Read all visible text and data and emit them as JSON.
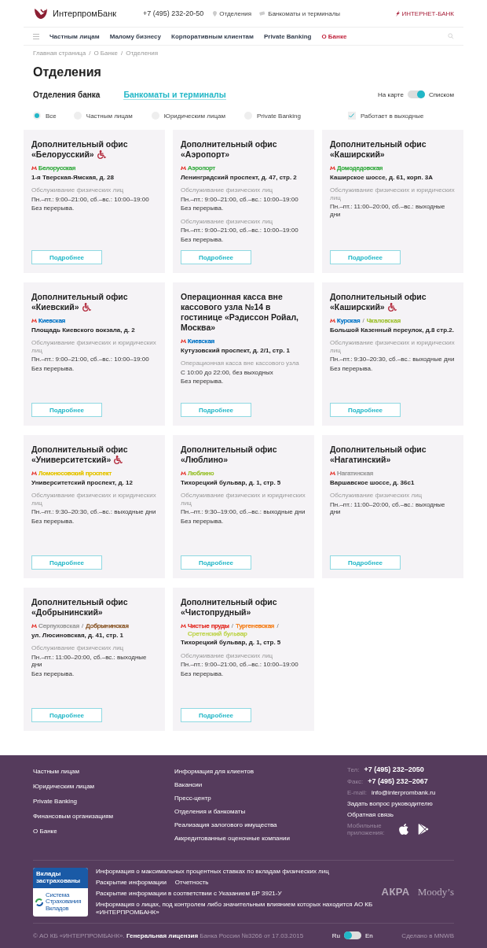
{
  "header": {
    "logo": "ИнтерпромБанк",
    "phone": "+7 (495) 232-20-50",
    "links": [
      {
        "label": "Отделения",
        "kind": "pin"
      },
      {
        "label": "Банкоматы и терминалы",
        "kind": "card"
      }
    ],
    "internet_bank": "ИНТЕРНЕТ-БАНК"
  },
  "nav": [
    {
      "label": "Частным лицам",
      "selected": false
    },
    {
      "label": "Малому бизнесу",
      "selected": false
    },
    {
      "label": "Корпоративным клиентам",
      "selected": false
    },
    {
      "label": "Private Banking",
      "selected": false
    },
    {
      "label": "О Банке",
      "selected": true
    }
  ],
  "breadcrumbs": [
    {
      "label": "Главная страница",
      "separator": "/"
    },
    {
      "label": "О Банке",
      "separator": "/"
    },
    {
      "label": "Отделения"
    }
  ],
  "title": "Отделения",
  "tabs": [
    {
      "label": "Отделения банка",
      "selected": true
    },
    {
      "label": "Банкоматы и терминалы",
      "selected": false
    }
  ],
  "view_toggle": {
    "left": "На карте",
    "right": "Списком",
    "on": true
  },
  "filters": [
    {
      "label": "Все",
      "selected": true
    },
    {
      "label": "Частным лицам",
      "selected": false
    },
    {
      "label": "Юридическим лицам",
      "selected": false
    },
    {
      "label": "Private Banking",
      "selected": false
    }
  ],
  "weekend_filter": {
    "label": "Работает в выходные",
    "checked": true
  },
  "offices": [
    {
      "title": "Дополнительный офис «Белорусский»",
      "accessible": true,
      "stations": [
        {
          "name": "Белорусская",
          "color": "#3fae49"
        }
      ],
      "address": "1-я Тверская-Ямская, д. 28",
      "schedules": [
        {
          "service": "Обслуживание физических лиц",
          "hours": "Пн.–пт.: 9:00–21:00, сб.–вс.: 10:00–19:00",
          "break": "Без перерыва."
        }
      ],
      "button": "Подробнее"
    },
    {
      "title": "Дополнительный офис «Аэропорт»",
      "accessible": false,
      "stations": [
        {
          "name": "Аэропорт",
          "color": "#3fae49"
        }
      ],
      "address": "Ленинградский проспект, д. 47, стр. 2",
      "schedules": [
        {
          "service": "Обслуживание физических лиц",
          "hours": "Пн.–пт.: 9:00–21:00, сб.–вс.: 10:00–19:00",
          "break": "Без перерыва."
        },
        {
          "service": "Обслуживание физических лиц",
          "hours": "Пн.–пт.: 9:00–21:00, сб.–вс.: 10:00–19:00",
          "break": "Без перерыва."
        }
      ],
      "button": "Подробнее"
    },
    {
      "title": "Дополнительный офис «Каширский»",
      "accessible": false,
      "stations": [
        {
          "name": "Домодедовская",
          "color": "#3fae49"
        }
      ],
      "address": "Каширское шоссе, д. 61, корп. 3А",
      "schedules": [
        {
          "service": "Обслуживание физических и юридических лиц",
          "hours": "Пн.–пт.: 11:00–20:00, сб.–вс.: выходные дни"
        }
      ],
      "button": "Подробнее"
    },
    {
      "title": "Дополнительный офис «Киевский»",
      "accessible": true,
      "stations": [
        {
          "name": "Киевская",
          "color": "#0a78c8"
        }
      ],
      "address": "Площадь Киевского вокзала, д. 2",
      "schedules": [
        {
          "service": "Обслуживание физических и юридических лиц",
          "hours": "Пн.–пт.: 9:00–21:00, сб.–вс.: 10:00–19:00",
          "break": "Без перерыва."
        }
      ],
      "button": "Подробнее"
    },
    {
      "title": "Операционная касса вне кассового узла №14 в гостинице «Рэдиссон Ройал, Москва»",
      "accessible": false,
      "stations": [
        {
          "name": "Киевская",
          "color": "#0a78c8"
        }
      ],
      "address": "Кутузовский проспект, д. 2/1, стр. 1",
      "schedules": [
        {
          "service": "Операционная касса вне кассового узла",
          "hours": "С 10:00 до 22:00, без выходных",
          "break": "Без перерыва."
        }
      ],
      "button": "Подробнее"
    },
    {
      "title": "Дополнительный офис «Каширский»",
      "accessible": true,
      "stations": [
        {
          "name": "Курская",
          "color": "#0a78c8"
        },
        {
          "separator": "/",
          "name": "Чкаловская",
          "color": "#a4c43b"
        }
      ],
      "address": "Большой Казенный переулок, д.8 стр.2.",
      "schedules": [
        {
          "service": "Обслуживание физических и юридических лиц",
          "hours": "Пн.–пт.: 9:30–20:30, сб.–вс.: выходные дни",
          "break": "Без перерыва."
        }
      ],
      "button": "Подробнее"
    },
    {
      "title": "Дополнительный офис «Университетский»",
      "accessible": true,
      "stations": [
        {
          "name": "Ломоносовский проспект",
          "color": "#e5c400"
        }
      ],
      "address": "Университетский проспект, д. 12",
      "schedules": [
        {
          "service": "Обслуживание физических и юридических лиц",
          "hours": "Пн.–пт.: 9:30–20:30, сб.–вс.: выходные дни",
          "break": "Без перерыва."
        }
      ],
      "button": "Подробнее"
    },
    {
      "title": "Дополнительный офис «Люблино»",
      "accessible": false,
      "stations": [
        {
          "name": "Люблино",
          "color": "#9fc43a"
        }
      ],
      "address": "Тихорецкий бульвар, д. 1, стр. 5",
      "schedules": [
        {
          "service": "Обслуживание физических и юридических лиц",
          "hours": "Пн.–пт.: 9:30–19:00, сб.–вс.: выходные дни",
          "break": "Без перерыва."
        }
      ],
      "button": "Подробнее"
    },
    {
      "title": "Дополнительный офис «Нагатинский»",
      "accessible": false,
      "stations": [
        {
          "name": "Нагатинская",
          "color": "#a0a0a0"
        }
      ],
      "address": "Варшавское шоссе, д. 36с1",
      "schedules": [
        {
          "service": "Обслуживание физических лиц",
          "hours": "Пн.–пт.: 11:00–20:00, сб.–вс.: выходные дни"
        }
      ],
      "button": "Подробнее"
    },
    {
      "title": "Дополнительный офис «Добрынинский»",
      "accessible": false,
      "stations": [
        {
          "name": "Серпуховская",
          "color": "#a0a0a0"
        },
        {
          "separator": "/",
          "name": "Добрынинская",
          "color": "#8d5b2d"
        }
      ],
      "address": "ул. Люсиновская, д. 41, стр. 1",
      "schedules": [
        {
          "service": "Обслуживание физических лиц",
          "hours": "Пн.–пт.: 11:00–20:00, сб.–вс.: выходные дни",
          "break": "Без перерыва."
        }
      ],
      "button": "Подробнее"
    },
    {
      "title": "Дополнительный офис «Чистопрудный»",
      "accessible": false,
      "stations": [
        {
          "name": "Чистые пруды",
          "color": "#e4322a"
        },
        {
          "separator": "/",
          "name": "Тургеневская",
          "color": "#f58220"
        },
        {
          "separator": "/",
          "name": "Сретенский бульвар",
          "color": "#c2d657"
        }
      ],
      "address": "Тихорецкий бульвар, д. 1, стр. 5",
      "schedules": [
        {
          "service": "Обслуживание физических лиц",
          "hours": "Пн.–пт.: 9:00–21:00, сб.–вс.: 10:00–19:00",
          "break": "Без перерыва."
        }
      ],
      "button": "Подробнее"
    }
  ],
  "footer": {
    "column_1": [
      "Частным лицам",
      "Юридическим лицам",
      "Private Banking",
      "Финансовым организациям",
      "О Банке"
    ],
    "column_2": [
      "Информация для клиентов",
      "Вакансии",
      "Пресс-центр",
      "Отделения и банкоматы",
      "Реализация залогового имущества",
      "Аккредитованные оценочные компании"
    ],
    "contacts": [
      {
        "label": "Тел:",
        "value": "+7 (495) 232–2050",
        "kind": "phone"
      },
      {
        "label": "Факс:",
        "value": "+7 (495) 232–2067",
        "kind": "phone"
      },
      {
        "label": "E-mail:",
        "value": "info@interprombank.ru",
        "kind": "email"
      }
    ],
    "contact_links": [
      "Задать вопрос руководителю",
      "Обратная связь"
    ],
    "apps_label": "Мобильные приложения:",
    "insurance_badge": {
      "title": "Вклады застрахованы",
      "caption": "Система Страхования Вкладов"
    },
    "disclosure_links": [
      [
        "Информация о максимальных процентных ставках по вкладам физических лиц"
      ],
      [
        "Раскрытие информации",
        "Отчетность"
      ],
      [
        "Раскрытие информации в соответствии с Указанием БР 3921-У"
      ],
      [
        "Информация о лицах, под контролем либо значительным влиянием которых находится АО КБ «ИНТЕРПРОМБАНК»"
      ]
    ],
    "ratings": [
      "АКРА",
      "Moody’s"
    ],
    "copyright": "© АО КБ «ИНТЕРПРОМБАНК». **Генеральная лицензия** Банка России №3266 от 17.03.2015",
    "language": {
      "left": "Ru",
      "right": "En",
      "on": false
    },
    "made_by": "Сделано в MNWB"
  }
}
